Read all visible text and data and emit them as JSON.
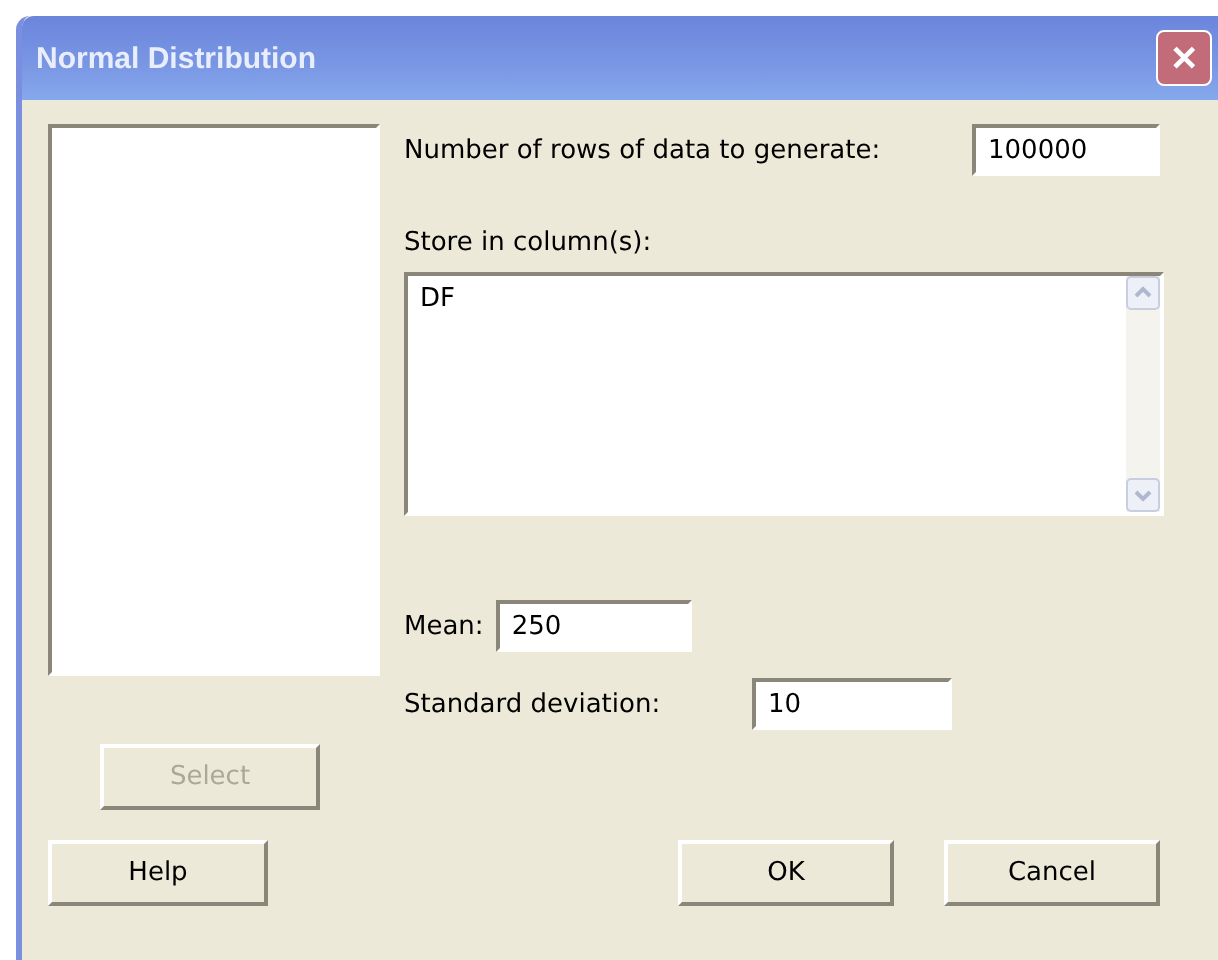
{
  "window": {
    "title": "Normal Distribution",
    "close": "✕"
  },
  "rows_field": {
    "label": "Number of rows of data to generate:",
    "value": "100000"
  },
  "store_field": {
    "label": "Store in column(s):",
    "value": "DF"
  },
  "mean_field": {
    "label": "Mean:",
    "value": "250"
  },
  "sd_field": {
    "label": "Standard deviation:",
    "value": "10"
  },
  "select_button": {
    "label": "Select",
    "disabled": true
  },
  "buttons": [
    {
      "label": "Help",
      "kind": "left"
    },
    {
      "label": "OK",
      "kind": "right"
    },
    {
      "label": "Cancel",
      "kind": "right"
    }
  ]
}
